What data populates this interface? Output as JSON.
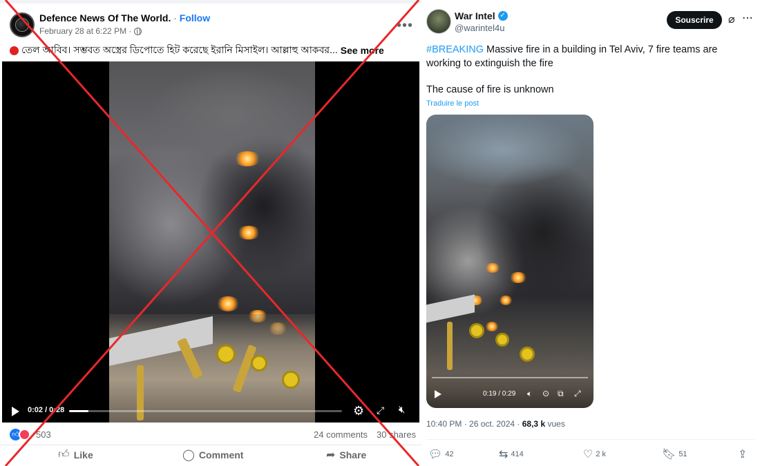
{
  "facebook": {
    "page_name": "Defence News Of The World.",
    "separator": "·",
    "follow_label": "Follow",
    "date": "February 28 at 6:22 PM ·",
    "caption": "তেল আবিব। সম্ভবত অস্ত্রের ডিপোতে হিট করেছে ইরানি মিসাইল। আল্লাহু আকবর...",
    "see_more": "See more",
    "video": {
      "time": "0:02 / 0:28",
      "progress": 0.07
    },
    "reaction_count": "503",
    "comments": "24 comments",
    "shares": "30 shares",
    "actions": {
      "like": "Like",
      "comment": "Comment",
      "share": "Share"
    }
  },
  "twitter": {
    "name": "War Intel",
    "handle": "@warintel4u",
    "subscribe_label": "Souscrire",
    "hashtag": "#BREAKING",
    "text": "Massive fire in a building in Tel Aviv, 7 fire teams are working to extinguish the fire",
    "text2": "The cause of fire is unknown",
    "translate": "Traduire le post",
    "video": {
      "time": "0:19 / 0:29"
    },
    "timestamp": "10:40 PM · 26 oct. 2024 · ",
    "views_count": "68,3 k",
    "views_label": "vues",
    "actions": {
      "replies": "42",
      "reposts": "414",
      "likes": "2 k",
      "bookmarks": "51"
    }
  },
  "colors": {
    "facebook_blue": "#1877f2",
    "twitter_blue": "#1d9bf0",
    "cross_red": "#e8282b"
  }
}
